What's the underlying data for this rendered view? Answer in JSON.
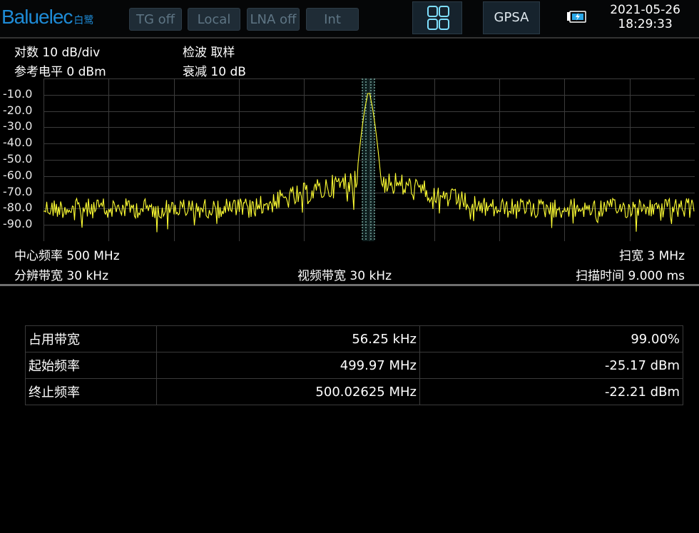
{
  "header": {
    "brand": "Baluelec",
    "brand_cn": "白鹭",
    "buttons": [
      "TG off",
      "Local",
      "LNA off",
      "Int"
    ],
    "mode": "GPSA",
    "date": "2021-05-26",
    "time": "18:29:33"
  },
  "params": {
    "scale": "对数 10 dB/div",
    "detector": "检波 取样",
    "ref_level": "参考电平 0 dBm",
    "attenuation": "衰减 10 dB",
    "center_freq": "中心频率 500 MHz",
    "span": "扫宽 3 MHz",
    "rbw": "分辨带宽 30 kHz",
    "vbw": "视频带宽 30 kHz",
    "sweep_time": "扫描时间 9.000 ms"
  },
  "y_labels": [
    "-10.0",
    "-20.0",
    "-30.0",
    "-40.0",
    "-50.0",
    "-60.0",
    "-70.0",
    "-80.0",
    "-90.0"
  ],
  "trace_color": "#ffff33",
  "results": [
    {
      "label": "占用带宽",
      "v1": "56.25 kHz",
      "v2": "99.00%"
    },
    {
      "label": "起始频率",
      "v1": "499.97 MHz",
      "v2": "-25.17 dBm"
    },
    {
      "label": "终止频率",
      "v1": "500.02625 MHz",
      "v2": "-22.21 dBm"
    }
  ]
}
